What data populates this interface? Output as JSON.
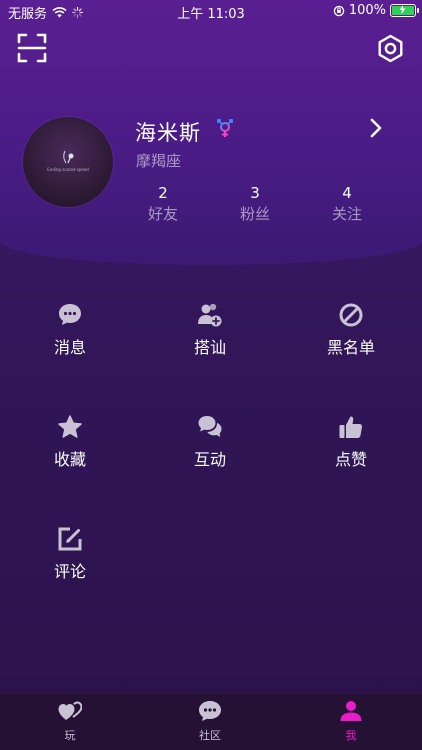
{
  "status_bar": {
    "carrier": "无服务",
    "time": "上午 11:03",
    "battery": "100%"
  },
  "profile": {
    "name": "海米斯",
    "zodiac": "摩羯座",
    "avatar_text": "Ending scared speed"
  },
  "stats": [
    {
      "value": "2",
      "label": "好友"
    },
    {
      "value": "3",
      "label": "粉丝"
    },
    {
      "value": "4",
      "label": "关注"
    }
  ],
  "menu": [
    {
      "label": "消息",
      "icon": "chat-bubble-icon"
    },
    {
      "label": "搭讪",
      "icon": "add-user-icon"
    },
    {
      "label": "黑名单",
      "icon": "block-icon"
    },
    {
      "label": "收藏",
      "icon": "star-icon"
    },
    {
      "label": "互动",
      "icon": "comments-icon"
    },
    {
      "label": "点赞",
      "icon": "thumbs-up-icon"
    },
    {
      "label": "评论",
      "icon": "edit-icon"
    }
  ],
  "tabs": [
    {
      "label": "玩",
      "icon": "hearts-icon",
      "active": false
    },
    {
      "label": "社区",
      "icon": "chat-icon",
      "active": false
    },
    {
      "label": "我",
      "icon": "person-icon",
      "active": true
    }
  ],
  "colors": {
    "accent": "#e81cc8",
    "header_bg": "#5a1f92",
    "body_bg": "#321659",
    "tabbar_bg": "#241134",
    "icon_gray": "#c8c2d4"
  }
}
